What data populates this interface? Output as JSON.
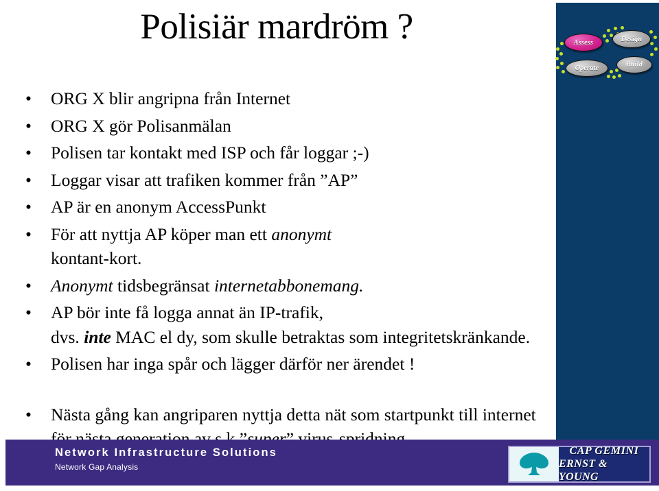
{
  "slide": {
    "title": "Polisiär mardröm ?",
    "bullet_glyph": "•",
    "bullets": [
      {
        "id": "b1",
        "text": "ORG X blir angripna från Internet"
      },
      {
        "id": "b2",
        "text": "ORG X gör Polisanmälan"
      },
      {
        "id": "b3",
        "text": "Polisen tar kontakt med ISP och får loggar ;-)"
      },
      {
        "id": "b4",
        "text": "Loggar visar att trafiken kommer från ”AP”"
      },
      {
        "id": "b5",
        "text": "AP är en anonym AccessPunkt"
      },
      {
        "id": "b6",
        "line1_plain": "För att nyttja AP köper man ett ",
        "line1_italic": "anonymt",
        "line2": "kontant-kort."
      },
      {
        "id": "b7",
        "italic1": "Anonymt",
        "plain": " tidsbegränsat ",
        "italic2": "internetabbonemang."
      },
      {
        "id": "b8",
        "line1": "AP bör inte få logga annat än IP-trafik,",
        "line2_pre": "dvs. ",
        "line2_bolditalic": "inte",
        "line2_post": " MAC el dy, som skulle betraktas som integritetskränkande."
      },
      {
        "id": "b9",
        "text": "Polisen har inga spår och lägger därför ner ärendet !"
      },
      {
        "id": "b10",
        "line1": "Nästa gång kan angriparen nyttja detta nät som startpunkt till internet",
        "line2_pre": "för nästa generation av s.k ”",
        "line2_italic": "super",
        "line2_post": "” virus-spridning ."
      }
    ]
  },
  "process_logo": {
    "nodes": [
      {
        "label": "Assess",
        "color": "#d4248f"
      },
      {
        "label": "Design",
        "color": "#a8a8a8"
      },
      {
        "label": "Build",
        "color": "#a8a8a8"
      },
      {
        "label": "Operate",
        "color": "#a8a8a8"
      }
    ],
    "dot_color": "#c7e02a",
    "background": "#0b3c68"
  },
  "footer": {
    "title": "Network Infrastructure Solutions",
    "subtitle": "Network Gap Analysis",
    "band_color": "#3c2b81",
    "logo": {
      "line1": "CAP GEMINI",
      "line2": "ERNST & YOUNG",
      "mark_color": "#0b9aa8"
    }
  }
}
